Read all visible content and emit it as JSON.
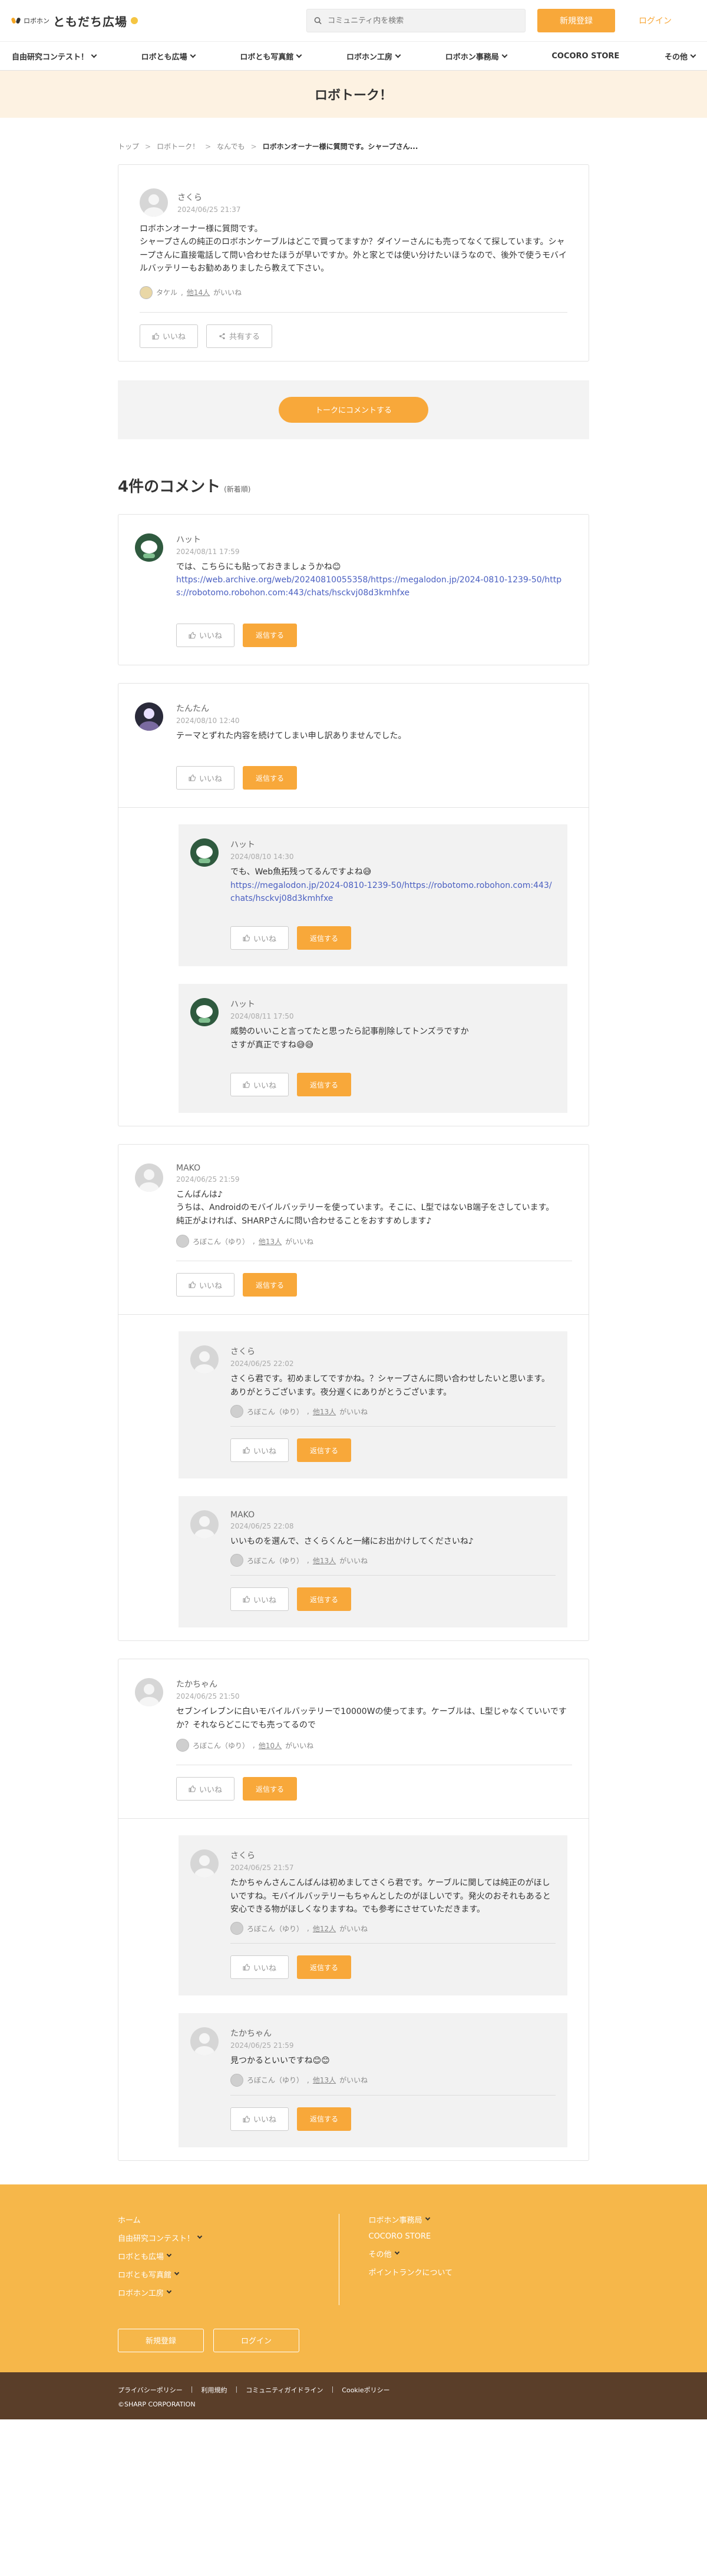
{
  "header": {
    "logo_small": "ロボホン",
    "logo_big": "ともだち広場",
    "search_placeholder": "コミュニティ内を検索",
    "signup": "新規登録",
    "login": "ログイン"
  },
  "nav": [
    {
      "label": "自由研究コンテスト！",
      "chev": true
    },
    {
      "label": "ロボとも広場",
      "chev": true
    },
    {
      "label": "ロボとも写真館",
      "chev": true
    },
    {
      "label": "ロボホン工房",
      "chev": true
    },
    {
      "label": "ロボホン事務局",
      "chev": true
    },
    {
      "label": "COCORO STORE",
      "chev": false
    },
    {
      "label": "その他",
      "chev": true
    }
  ],
  "page_title": "ロボトーク！",
  "breadcrumb": [
    "トップ",
    "ロボトーク！",
    "なんでも",
    "ロボホンオーナー様に質問です。シャープさん..."
  ],
  "post": {
    "user": "さくら",
    "date": "2024/06/25 21:37",
    "body": "ロボホンオーナー様に質問です。\nシャープさんの純正のロボホンケーブルはどこで買ってますか？ダイソーさんにも売ってなくて探しています。シャープさんに直接電話して問い合わせたほうが早いですか。外と家とでは使い分けたいほうなので、後外で使うモバイルバッテリーもお勧めありましたら教えて下さい。",
    "liker_name": "タケル",
    "liker_link": "他14人",
    "liker_suffix": "がいいね",
    "like_label": "いいね",
    "share_label": "共有する"
  },
  "cta": "トークにコメントする",
  "comments_header": {
    "count": "4件のコメント",
    "sort": "(新着順)"
  },
  "comments": [
    {
      "user": "ハット",
      "date": "2024/08/11 17:59",
      "text": "では、こちらにも貼っておきましょうかね😊",
      "link": "https://web.archive.org/web/20240810055358/https://megalodon.jp/2024-0810-1239-50/https://robotomo.robohon.com:443/chats/hsckvj08d3kmhfxe",
      "avatar": "robot",
      "liker": null,
      "replies": []
    },
    {
      "user": "たんたん",
      "date": "2024/08/10 12:40",
      "text": "テーマとずれた内容を続けてしまい申し訳ありませんでした。",
      "link": null,
      "avatar": "dark",
      "liker": null,
      "replies": [
        {
          "user": "ハット",
          "date": "2024/08/10 14:30",
          "text": "でも、Web魚拓残ってるんですよね😅",
          "link": "https://megalodon.jp/2024-0810-1239-50/https://robotomo.robohon.com:443/chats/hsckvj08d3kmhfxe",
          "avatar": "robot",
          "liker": null
        },
        {
          "user": "ハット",
          "date": "2024/08/11 17:50",
          "text": "威勢のいいこと言ってたと思ったら記事削除してトンズラですか\nさすが真正ですね😅😅",
          "link": null,
          "avatar": "robot",
          "liker": null
        }
      ]
    },
    {
      "user": "MAKO",
      "date": "2024/06/25 21:59",
      "text": "こんばんは♪\nうちは、Androidのモバイルバッテリーを使っています。そこに、L型ではないB端子をさしています。\n純正がよければ、SHARPさんに問い合わせることをおすすめします♪",
      "link": null,
      "avatar": "gray",
      "liker": {
        "name": "ろぼこん（ゆり）",
        "link": "他13人",
        "suffix": "がいいね"
      },
      "replies": [
        {
          "user": "さくら",
          "date": "2024/06/25 22:02",
          "text": "さくら君です。初めましてですかね。？シャープさんに問い合わせしたいと思います。\nありがとうございます。夜分遅くにありがとうございます。",
          "link": null,
          "avatar": "gray",
          "liker": {
            "name": "ろぼこん（ゆり）",
            "link": "他13人",
            "suffix": "がいいね"
          }
        },
        {
          "user": "MAKO",
          "date": "2024/06/25 22:08",
          "text": "いいものを選んで、さくらくんと一緒にお出かけしてくださいね♪",
          "link": null,
          "avatar": "gray",
          "liker": {
            "name": "ろぼこん（ゆり）",
            "link": "他13人",
            "suffix": "がいいね"
          }
        }
      ]
    },
    {
      "user": "たかちゃん",
      "date": "2024/06/25 21:50",
      "text": "セブンイレブンに白いモバイルバッテリーで10000Wの使ってます。ケーブルは、L型じゃなくていいですか？それならどこにでも売ってるので",
      "link": null,
      "avatar": "gray",
      "liker": {
        "name": "ろぼこん（ゆり）",
        "link": "他10人",
        "suffix": "がいいね"
      },
      "replies": [
        {
          "user": "さくら",
          "date": "2024/06/25 21:57",
          "text": "たかちゃんさんこんばんは初めましてさくら君です。ケーブルに関しては純正のがほしいですね。モバイルバッテリーもちゃんとしたのがほしいです。発火のおそれもあると安心できる物がほしくなりますね。でも参考にさせていただきます。",
          "link": null,
          "avatar": "gray",
          "liker": {
            "name": "ろぼこん（ゆり）",
            "link": "他12人",
            "suffix": "がいいね"
          }
        },
        {
          "user": "たかちゃん",
          "date": "2024/06/25 21:59",
          "text": "見つかるといいですね😊😊",
          "link": null,
          "avatar": "gray",
          "liker": {
            "name": "ろぼこん（ゆり）",
            "link": "他13人",
            "suffix": "がいいね"
          }
        }
      ]
    }
  ],
  "buttons": {
    "like": "いいね",
    "reply": "返信する"
  },
  "footer": {
    "left": [
      {
        "label": "ホーム",
        "chev": false
      },
      {
        "label": "自由研究コンテスト！",
        "chev": true
      },
      {
        "label": "ロボとも広場",
        "chev": true
      },
      {
        "label": "ロボとも写真館",
        "chev": true
      },
      {
        "label": "ロボホン工房",
        "chev": true
      }
    ],
    "right": [
      {
        "label": "ロボホン事務局",
        "chev": true
      },
      {
        "label": "COCORO STORE",
        "chev": false
      },
      {
        "label": "その他",
        "chev": true
      },
      {
        "label": "ポイントランクについて",
        "chev": false
      }
    ],
    "signup": "新規登録",
    "login": "ログイン",
    "bottom_links": [
      "プライバシーポリシー",
      "利用規約",
      "コミュニティガイドライン",
      "Cookieポリシー"
    ],
    "copyright": "©SHARP CORPORATION"
  },
  "colors": {
    "accent": "#f8a83a",
    "title_band": "#fdf2e2",
    "footer": "#f6b74a",
    "bottom": "#5a3e29",
    "link": "#4a5fc1"
  }
}
